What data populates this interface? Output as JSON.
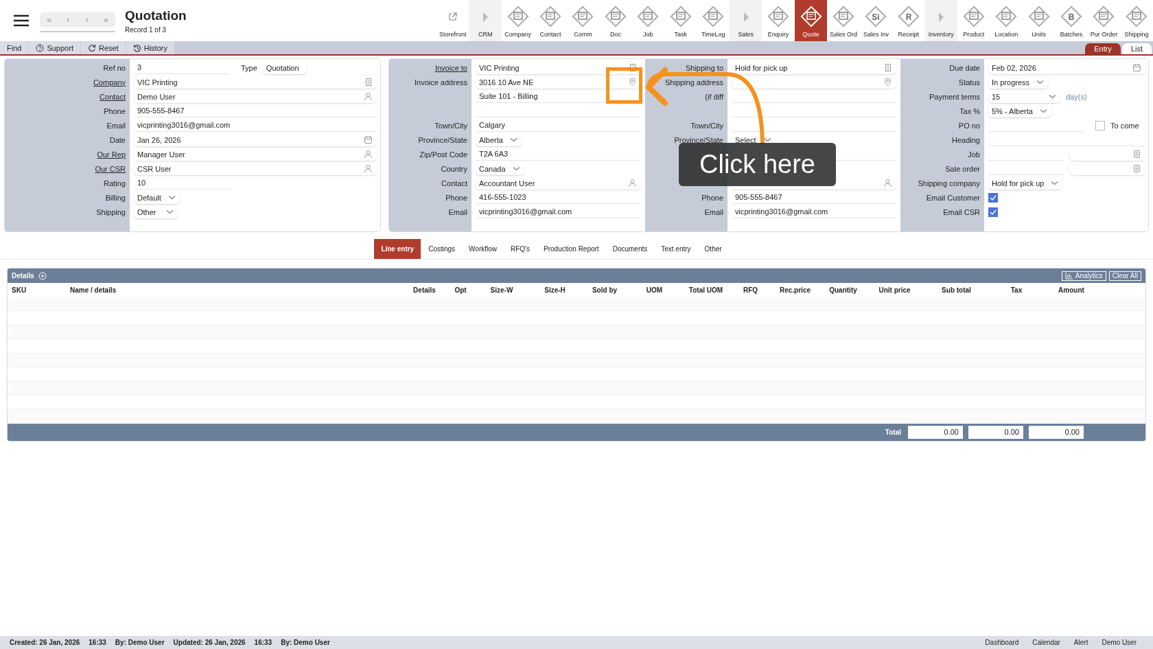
{
  "header": {
    "nav_buttons": [
      {
        "symbol": "«",
        "disabled": true
      },
      {
        "symbol": "‹",
        "disabled": true
      },
      {
        "symbol": "›",
        "disabled": true
      },
      {
        "symbol": "»",
        "disabled": true
      }
    ],
    "title": "Quotation",
    "subtitle": "Record 1 of 3"
  },
  "modules": [
    {
      "label": "Storefront",
      "kind": "link",
      "selected": false
    },
    {
      "label": "CRM",
      "kind": "section",
      "selected": false
    },
    {
      "label": "Company",
      "kind": "module",
      "selected": false
    },
    {
      "label": "Contact",
      "kind": "module",
      "selected": false
    },
    {
      "label": "Comm",
      "kind": "module",
      "selected": false
    },
    {
      "label": "Doc",
      "kind": "module",
      "selected": false
    },
    {
      "label": "Job",
      "kind": "module",
      "selected": false
    },
    {
      "label": "Task",
      "kind": "module",
      "selected": false
    },
    {
      "label": "TimeLog",
      "kind": "module",
      "selected": false
    },
    {
      "label": "Sales",
      "kind": "section",
      "selected": false
    },
    {
      "label": "Enquiry",
      "kind": "module",
      "selected": false
    },
    {
      "label": "Quote",
      "kind": "module",
      "selected": true
    },
    {
      "label": "Sales Ord",
      "kind": "module",
      "selected": false
    },
    {
      "label": "Sales Inv",
      "kind": "module",
      "glyph": "Si",
      "selected": false
    },
    {
      "label": "Receipt",
      "kind": "module",
      "glyph": "R",
      "selected": false
    },
    {
      "label": "Inventory",
      "kind": "section",
      "selected": false
    },
    {
      "label": "Product",
      "kind": "module",
      "selected": false
    },
    {
      "label": "Location",
      "kind": "module",
      "selected": false
    },
    {
      "label": "Units",
      "kind": "module",
      "selected": false
    },
    {
      "label": "Batches",
      "kind": "module",
      "glyph": "B",
      "selected": false
    },
    {
      "label": "Pur Order",
      "kind": "module",
      "selected": false
    },
    {
      "label": "Shipping",
      "kind": "module",
      "selected": false
    }
  ],
  "actions": [
    {
      "label": "Find",
      "kind": "plain"
    },
    {
      "label": "Support",
      "kind": "help"
    },
    {
      "label": "Reset",
      "kind": "reset"
    },
    {
      "label": "History",
      "kind": "history"
    }
  ],
  "views": [
    {
      "label": "Entry",
      "selected": true
    },
    {
      "label": "List",
      "selected": false
    }
  ],
  "panels": [
    {
      "sections": [
        {
          "rows": [
            {
              "label": "Ref no",
              "kind": "short",
              "value": "3",
              "extra": {
                "kind": "select",
                "label": "Type",
                "value": "Quotation"
              }
            },
            {
              "label": "Company",
              "link": true,
              "kind": "company",
              "value": "VIC Printing"
            },
            {
              "label": "Contact",
              "link": true,
              "kind": "person",
              "value": "Demo User"
            },
            {
              "label": "Phone",
              "kind": "text",
              "value": "905-555-8467"
            },
            {
              "label": "Email",
              "kind": "text",
              "value": "vicprinting3016@gmail.com"
            },
            {
              "label": "Date",
              "kind": "date",
              "value": "Jan 26, 2026"
            },
            {
              "label": "Our Rep",
              "link": true,
              "kind": "person",
              "value": "Manager User"
            },
            {
              "label": "Our CSR",
              "link": true,
              "kind": "person",
              "value": "CSR User"
            },
            {
              "label": "Rating",
              "kind": "short",
              "value": "10"
            },
            {
              "label": "Billing",
              "kind": "select",
              "value": "Default"
            },
            {
              "label": "Shipping",
              "kind": "select",
              "value": "Other"
            }
          ]
        }
      ]
    },
    {
      "sections": [
        {
          "rows": [
            {
              "label": "Invoice to",
              "link": true,
              "kind": "company",
              "value": "VIC Printing"
            },
            {
              "label": "Invoice address",
              "kind": "address",
              "value": "3016 10 Ave NE"
            },
            {
              "kind": "text",
              "value": "Suite 101 - Billing"
            },
            {
              "kind": "text"
            },
            {
              "label": "Town/City",
              "kind": "text",
              "value": "Calgary"
            },
            {
              "label": "Province/State",
              "kind": "select",
              "value": "Alberta"
            },
            {
              "label": "Zip/Post Code",
              "kind": "text",
              "value": "T2A 6A3"
            },
            {
              "label": "Country",
              "kind": "select",
              "value": "Canada"
            },
            {
              "label": "Contact",
              "kind": "person",
              "value": "Accountant User"
            },
            {
              "label": "Phone",
              "kind": "text",
              "value": "416-555-1023"
            },
            {
              "label": "Email",
              "kind": "text",
              "value": "vicprinting3016@gmail.com"
            }
          ]
        },
        {
          "rows": [
            {
              "label": "Shipping to",
              "kind": "company",
              "value": "Hold for pick up"
            },
            {
              "label": "Shipping address",
              "kind": "address"
            },
            {
              "label": "(if diff",
              "kind": "text"
            },
            {
              "kind": "text"
            },
            {
              "label": "Town/City",
              "kind": "text"
            },
            {
              "label": "Province/State",
              "kind": "select",
              "value": "Select"
            },
            {
              "kind": "text"
            },
            {
              "kind": "select"
            },
            {
              "kind": "person"
            },
            {
              "label": "Phone",
              "kind": "text",
              "value": "905-555-8467"
            },
            {
              "label": "Email",
              "kind": "text",
              "value": "vicprinting3016@gmail.com"
            }
          ]
        },
        {
          "rows": [
            {
              "label": "Due date",
              "kind": "date",
              "value": "Feb 02, 2026"
            },
            {
              "label": "Status",
              "kind": "select",
              "value": "In progress"
            },
            {
              "label": "Payment terms",
              "kind": "select",
              "value": "15",
              "suffix": "day(s)"
            },
            {
              "label": "Tax %",
              "kind": "select",
              "value": "5% - Alberta"
            },
            {
              "label": "PO no",
              "kind": "short",
              "extra": {
                "kind": "check",
                "label": "To come",
                "checked": false
              }
            },
            {
              "label": "Heading",
              "kind": "text"
            },
            {
              "label": "Job",
              "kind": "pair"
            },
            {
              "label": "Sale order",
              "kind": "pair"
            },
            {
              "label": "Shipping company",
              "kind": "select",
              "value": "Hold for pick up"
            },
            {
              "label": "Email Customer",
              "kind": "check",
              "checked": true
            },
            {
              "label": "Email CSR",
              "kind": "check",
              "checked": true
            }
          ]
        }
      ]
    }
  ],
  "tabs": [
    {
      "label": "Line entry",
      "selected": true
    },
    {
      "label": "Costings",
      "selected": false
    },
    {
      "label": "Workflow",
      "selected": false
    },
    {
      "label": "RFQ's",
      "selected": false
    },
    {
      "label": "Production Report",
      "selected": false
    },
    {
      "label": "Documents",
      "selected": false
    },
    {
      "label": "Text entry",
      "selected": false
    },
    {
      "label": "Other",
      "selected": false
    }
  ],
  "details": {
    "title": "Details",
    "buttons": [
      {
        "label": "Analytics",
        "kind": "chart"
      },
      {
        "label": "Clear All",
        "kind": "plain"
      }
    ],
    "columns": [
      "SKU",
      "Name / details",
      "Details",
      "Opt",
      "Size-W",
      "Size-H",
      "Sold by",
      "UOM",
      "Total UOM",
      "RFQ",
      "Rec.price",
      "Quantity",
      "Unit price",
      "Sub total",
      "Tax",
      "Amount"
    ],
    "total_label": "Total",
    "totals": [
      "0.00",
      "0.00",
      "0.00"
    ]
  },
  "callout": {
    "text": "Click here"
  },
  "status_bar": {
    "left": [
      "Created: 26 Jan, 2026",
      "16:33",
      "By: Demo User",
      "Updated: 26 Jan, 2026",
      "16:33",
      "By: Demo User"
    ],
    "right": [
      "Dashboard",
      "Calendar",
      "Alert",
      "Demo User"
    ]
  }
}
